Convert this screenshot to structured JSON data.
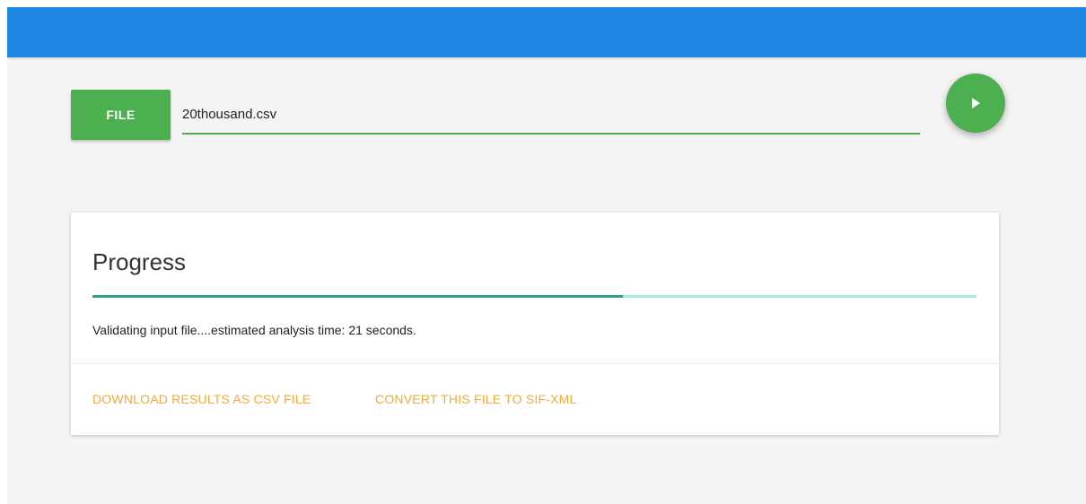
{
  "colors": {
    "topbar": "#2088e3",
    "primary_green": "#4caf50",
    "progress_fill": "#2e9e8c",
    "progress_track": "#a6ebe6",
    "action_text": "#f7a83a",
    "page_background": "#f4f4f4"
  },
  "file_picker": {
    "button_label": "FILE",
    "file_name": "20thousand.csv"
  },
  "run_button": {
    "icon": "play-icon"
  },
  "progress_card": {
    "title": "Progress",
    "progress_fraction": 0.6,
    "status": "Validating input file....estimated analysis time: 21 seconds.",
    "actions": [
      "DOWNLOAD RESULTS AS CSV FILE",
      "CONVERT THIS FILE TO SIF-XML"
    ]
  }
}
